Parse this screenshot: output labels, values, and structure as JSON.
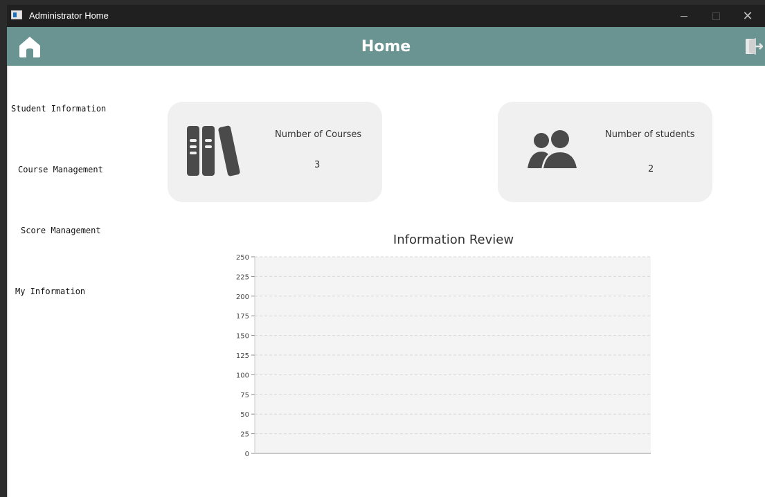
{
  "window": {
    "title": "Administrator Home"
  },
  "navbar": {
    "title": "Home",
    "home_icon": "home-icon",
    "logout_icon": "logout-icon"
  },
  "sidebar": {
    "items": [
      {
        "label": "Student Information"
      },
      {
        "label": "Course Management"
      },
      {
        "label": "Score Management"
      },
      {
        "label": "My Information"
      }
    ]
  },
  "cards": {
    "courses": {
      "label": "Number of  Courses",
      "value": "3",
      "icon": "books-icon"
    },
    "students": {
      "label": "Number of students",
      "value": "2",
      "icon": "users-icon"
    }
  },
  "colors": {
    "navbar": "#6a9492",
    "card": "#f0f0f0",
    "icon": "#4a4a4a",
    "plot_bg": "#f4f4f4"
  },
  "chart_data": {
    "type": "bar",
    "title": "Information Review",
    "xlabel": "",
    "ylabel": "",
    "categories": [],
    "values": [],
    "ylim": [
      0,
      250
    ],
    "yticks": [
      "0",
      "25",
      "50",
      "75",
      "100",
      "125",
      "150",
      "175",
      "200",
      "225",
      "250"
    ],
    "grid": true
  }
}
